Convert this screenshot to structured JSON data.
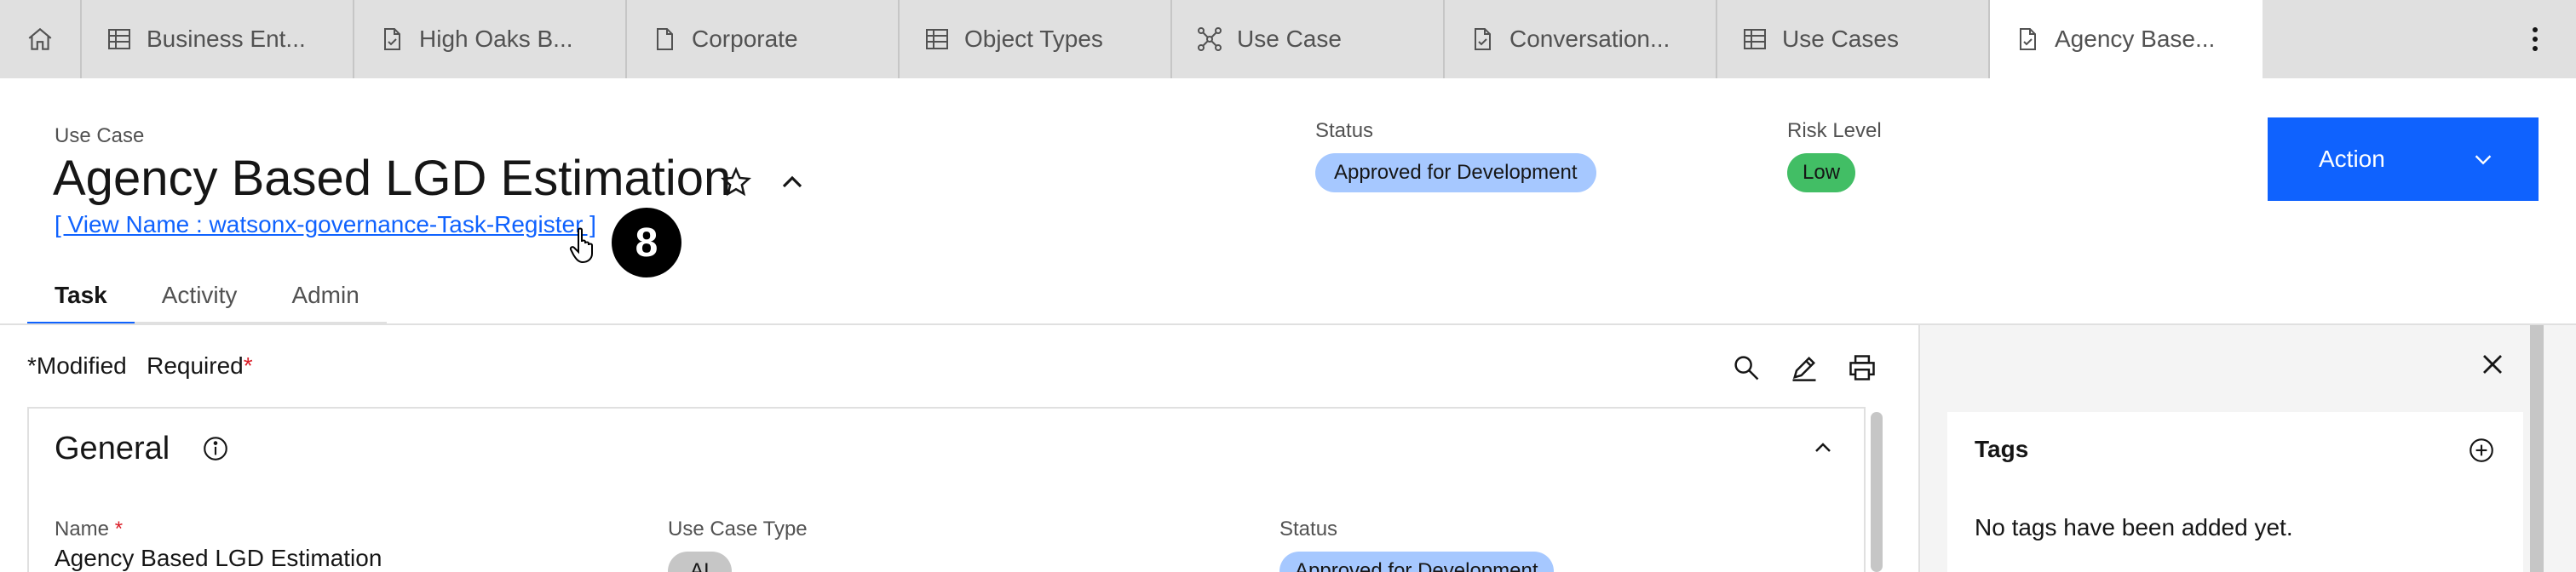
{
  "tabs": {
    "home_icon": "home-icon",
    "items": [
      {
        "label": "Business Ent...",
        "icon": "table-icon"
      },
      {
        "label": "High Oaks B...",
        "icon": "document-check-icon"
      },
      {
        "label": "Corporate",
        "icon": "document-icon"
      },
      {
        "label": "Object Types",
        "icon": "table-icon"
      },
      {
        "label": "Use Case",
        "icon": "network-icon"
      },
      {
        "label": "Conversation...",
        "icon": "document-check-icon"
      },
      {
        "label": "Use Cases",
        "icon": "table-icon"
      },
      {
        "label": "Agency Base...",
        "icon": "document-check-icon",
        "active": true
      }
    ],
    "overflow_icon": "overflow-menu-icon"
  },
  "header": {
    "eyebrow": "Use Case",
    "title": "Agency Based LGD Estimation",
    "view_link": "[ View Name : watsonx-governance-Task-Register ]",
    "step_badge": "8",
    "status_label": "Status",
    "status_value": "Approved for Development",
    "risk_label": "Risk Level",
    "risk_value": "Low",
    "action_label": "Action"
  },
  "subtabs": [
    "Task",
    "Activity",
    "Admin"
  ],
  "toolbar": {
    "modified_mark": "*",
    "modified_label": "Modified",
    "required_label": "Required",
    "required_mark": "*"
  },
  "general": {
    "title": "General",
    "fields": {
      "name_label": "Name",
      "name_required": "*",
      "name_value": "Agency Based LGD Estimation",
      "type_label": "Use Case Type",
      "type_value": "AI",
      "status_label": "Status",
      "status_value": "Approved for Development"
    }
  },
  "side_panel": {
    "tags_title": "Tags",
    "tags_empty": "No tags have been added yet."
  },
  "colors": {
    "accent": "#0f62fe",
    "status_pill": "#a6c8ff",
    "risk_low": "#42be65",
    "required": "#da1e28"
  }
}
